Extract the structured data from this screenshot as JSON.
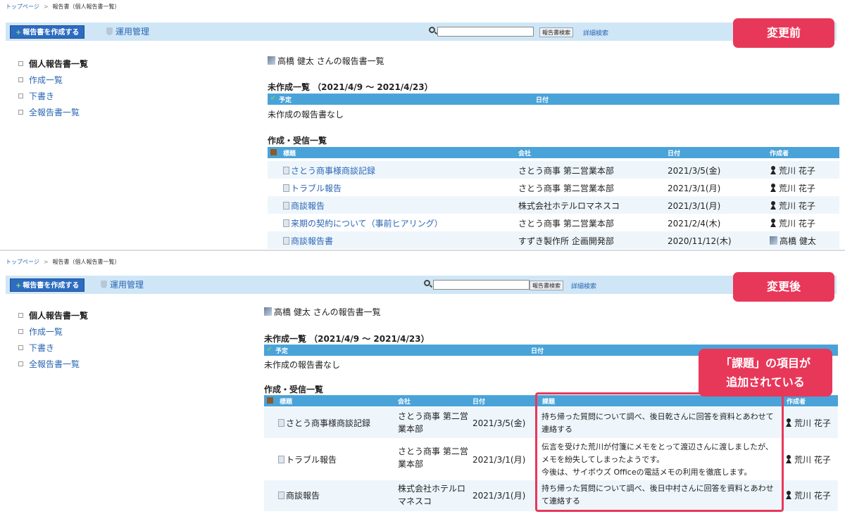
{
  "breadcrumb": {
    "home": "トップページ",
    "separator": ">",
    "current": "報告書（個人報告書一覧）"
  },
  "toolbar": {
    "create_label": "報告書を作成する",
    "create_plus": "+",
    "admin_label": "運用管理",
    "search_button": "報告書検索",
    "advanced_search": "詳細検索",
    "search_value": ""
  },
  "badges": {
    "before": "変更前",
    "after": "変更後"
  },
  "callout": {
    "line1": "「課題」の項目が",
    "line2": "追加されている"
  },
  "sidebar": {
    "items": [
      {
        "label": "個人報告書一覧",
        "current": true
      },
      {
        "label": "作成一覧"
      },
      {
        "label": "下書き"
      },
      {
        "label": "全報告書一覧"
      }
    ]
  },
  "owner_title": "高橋 健太 さんの報告書一覧",
  "pending": {
    "title": "未作成一覧 （2021/4/9 ～ 2021/4/23）",
    "col_plan": "予定",
    "col_date": "日付",
    "empty": "未作成の報告書なし"
  },
  "received": {
    "title": "作成・受信一覧",
    "cols": {
      "title": "標題",
      "company": "会社",
      "date": "日付",
      "issue": "課題",
      "author": "作成者"
    },
    "rows_before": [
      {
        "title": "さとう商事様商談記録",
        "company": "さとう商事 第二営業本部",
        "date": "2021/3/5(金)",
        "author": "荒川 花子",
        "author_icon": "woman-icon"
      },
      {
        "title": "トラブル報告",
        "company": "さとう商事 第二営業本部",
        "date": "2021/3/1(月)",
        "author": "荒川 花子",
        "author_icon": "woman-icon"
      },
      {
        "title": "商談報告",
        "company": "株式会社ホテルロマネスコ",
        "date": "2021/3/1(月)",
        "author": "荒川 花子",
        "author_icon": "woman-icon"
      },
      {
        "title": "来期の契約について（事前ヒアリング）",
        "company": "さとう商事 第二営業本部",
        "date": "2021/2/4(木)",
        "author": "荒川 花子",
        "author_icon": "woman-icon"
      },
      {
        "title": "商談報告書",
        "company": "すずき製作所 企画開発部",
        "date": "2020/11/12(木)",
        "author": "高橋 健太",
        "author_icon": "man-icon"
      }
    ],
    "rows_after": [
      {
        "title": "さとう商事様商談記録",
        "company_l1": "さとう商事 第二営",
        "company_l2": "業本部",
        "date": "2021/3/5(金)",
        "issue_lines": [
          "持ち帰った質問について調べ、後日乾さんに回答を資料とあわせて",
          "連絡する"
        ],
        "author": "荒川 花子"
      },
      {
        "title": "トラブル報告",
        "company_l1": "さとう商事 第二営",
        "company_l2": "業本部",
        "date": "2021/3/1(月)",
        "issue_lines": [
          "伝言を受けた荒川が付箋にメモをとって渡辺さんに渡しましたが、",
          "メモを紛失してしまったようです。",
          "今後は、サイボウズ Officeの電話メモの利用を徹底します。"
        ],
        "author": "荒川 花子"
      },
      {
        "title": "商談報告",
        "company_l1": "株式会社ホテルロ",
        "company_l2": "マネスコ",
        "date": "2021/3/1(月)",
        "issue_lines": [
          "持ち帰った質問について調べ、後日中村さんに回答を資料とあわせ",
          "て連絡する"
        ],
        "author": "荒川 花子"
      }
    ]
  },
  "colors": {
    "accent": "#e8385a",
    "header": "#4aa3d8",
    "toolbar": "#cfe6f6",
    "link": "#2a66b3",
    "create_button": "#2d6cc0"
  },
  "icons": {
    "search": "search-icon",
    "admin": "shield-icon",
    "doc": "document-icon",
    "header_home": "home-icon"
  }
}
